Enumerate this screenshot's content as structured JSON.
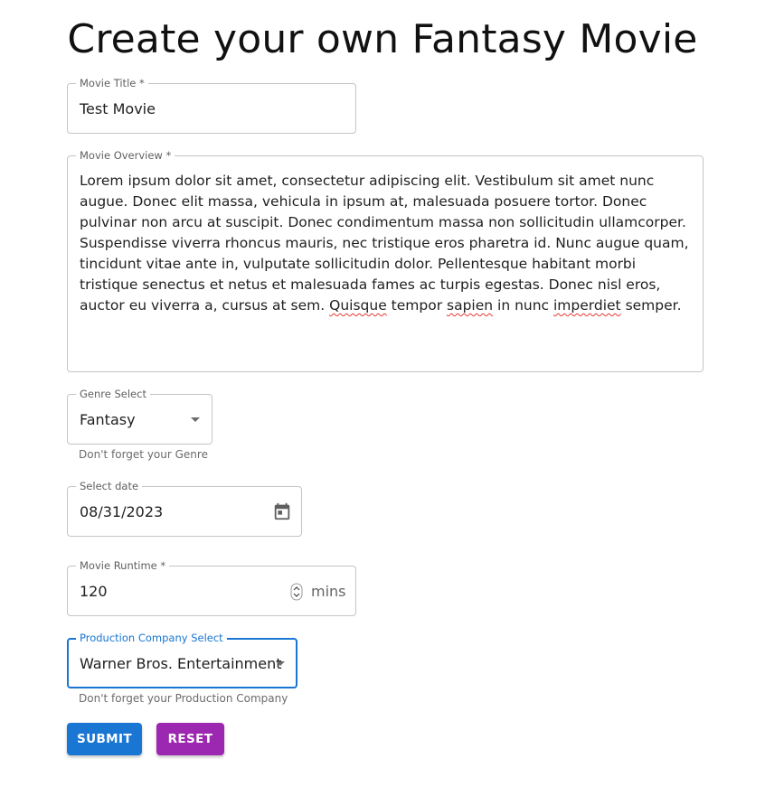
{
  "page": {
    "title": "Create your own Fantasy Movie"
  },
  "movie_title": {
    "label": "Movie Title",
    "required_mark": "*",
    "value": "Test Movie"
  },
  "overview": {
    "label": "Movie Overview",
    "required_mark": "*",
    "segments": [
      {
        "text": "Lorem ipsum dolor sit amet, consectetur adipiscing elit. Vestibulum sit amet nunc augue. Donec elit massa, vehicula in ipsum at, malesuada posuere tortor. Donec pulvinar non arcu at suscipit. Donec condimentum massa non sollicitudin ullamcorper. Suspendisse viverra rhoncus mauris, nec tristique eros pharetra id. Nunc augue quam, tincidunt vitae ante in, vulputate sollicitudin dolor. Pellentesque habitant morbi tristique senectus et netus et malesuada fames ac turpis egestas. Donec nisl eros, auctor eu viverra a, cursus at sem. ",
        "misspelled": false
      },
      {
        "text": "Quisque",
        "misspelled": true
      },
      {
        "text": " tempor ",
        "misspelled": false
      },
      {
        "text": "sapien",
        "misspelled": true
      },
      {
        "text": " in nunc ",
        "misspelled": false
      },
      {
        "text": "imperdiet",
        "misspelled": true
      },
      {
        "text": " semper.",
        "misspelled": false
      }
    ]
  },
  "genre": {
    "label": "Genre Select",
    "value": "Fantasy",
    "helper": "Don't forget your Genre",
    "icon": "dropdown-arrow-icon"
  },
  "date": {
    "label": "Select date",
    "value": "08/31/2023",
    "icon": "calendar-icon"
  },
  "runtime": {
    "label": "Movie Runtime",
    "required_mark": "*",
    "value": "120",
    "unit": "mins",
    "icon": "number-spinner-icon"
  },
  "production": {
    "label": "Production Company Select",
    "value": "Warner Bros. Entertainment",
    "helper": "Don't forget your Production Company",
    "icon": "dropdown-arrow-icon"
  },
  "buttons": {
    "submit": "SUBMIT",
    "reset": "RESET"
  },
  "colors": {
    "submit": "#1976d2",
    "reset": "#9c27b0",
    "focus": "#1976d2",
    "border": "#c4c4c4",
    "spellcheck": "#e53935"
  }
}
